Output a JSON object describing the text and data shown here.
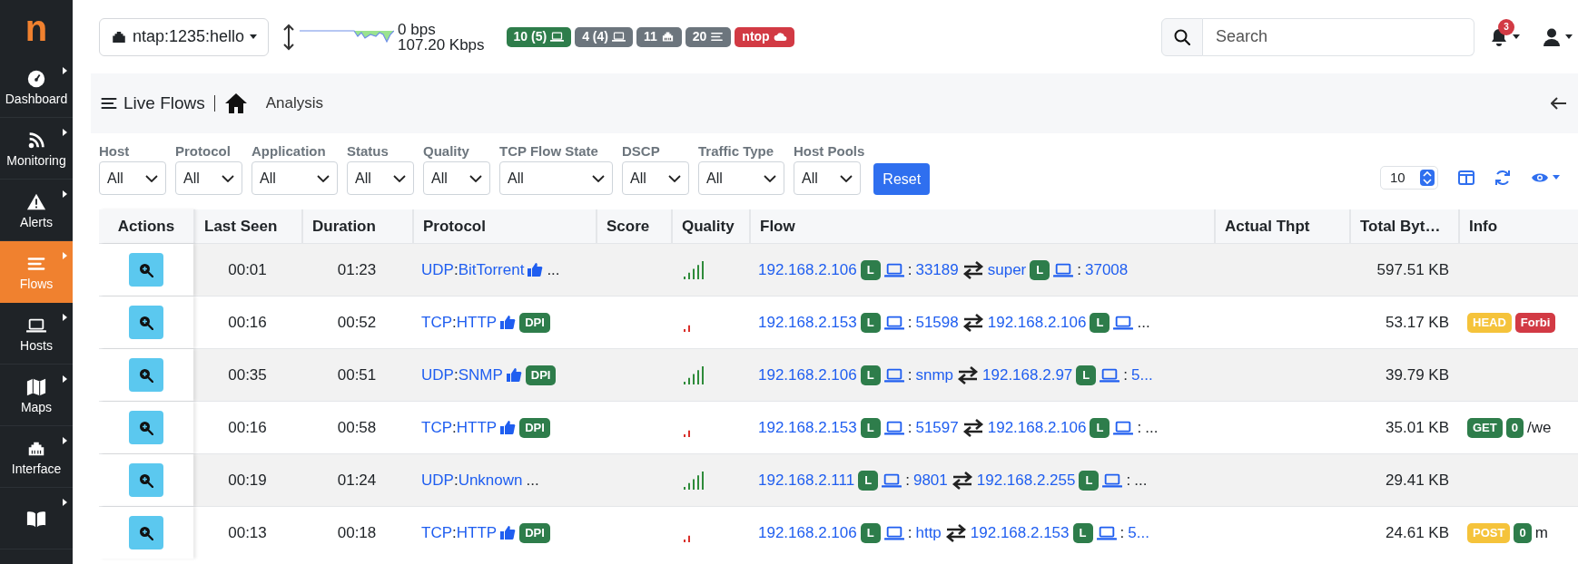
{
  "logo": "n",
  "sidebar": {
    "items": [
      {
        "label": "Dashboard",
        "kind": "gauge",
        "selected": false
      },
      {
        "label": "Monitoring",
        "kind": "signal",
        "selected": false
      },
      {
        "label": "Alerts",
        "kind": "warning",
        "selected": false
      },
      {
        "label": "Flows",
        "kind": "lines",
        "selected": true
      },
      {
        "label": "Hosts",
        "kind": "laptop",
        "selected": false
      },
      {
        "label": "Maps",
        "kind": "map",
        "selected": false
      },
      {
        "label": "Interface",
        "kind": "ethernet",
        "selected": false
      },
      {
        "kind": "book",
        "selected": false
      }
    ]
  },
  "topbar": {
    "interface": "ntap:1235:hello",
    "upload": "0 bps",
    "download": "107.20 Kbps",
    "badges": [
      {
        "text": "10 (5)",
        "kind": "laptop",
        "color": "#2e7d4b"
      },
      {
        "text": "4 (4)",
        "kind": "laptop",
        "color": "#6c757d"
      },
      {
        "text": "11",
        "kind": "ethernet",
        "color": "#6c757d"
      },
      {
        "text": "20",
        "kind": "lines",
        "color": "#6c757d"
      },
      {
        "text": "ntop",
        "kind": "cloud",
        "color": "#d23a44"
      }
    ],
    "search": {
      "placeholder": "Search"
    },
    "notifications": "3"
  },
  "breadcrumb": {
    "title": "Live Flows",
    "page": "Analysis"
  },
  "filters": [
    {
      "label": "Host",
      "value": "All"
    },
    {
      "label": "Protocol",
      "value": "All"
    },
    {
      "label": "Application",
      "value": "All"
    },
    {
      "label": "Status",
      "value": "All"
    },
    {
      "label": "Quality",
      "value": "All"
    },
    {
      "label": "TCP Flow State",
      "value": "All"
    },
    {
      "label": "DSCP",
      "value": "All"
    },
    {
      "label": "Traffic Type",
      "value": "All"
    },
    {
      "label": "Host Pools",
      "value": "All"
    }
  ],
  "reset": "Reset",
  "page_size": "10",
  "table": {
    "columns": [
      "Actions",
      "Last Seen",
      "Duration",
      "Protocol",
      "Score",
      "Quality",
      "Flow",
      "Actual Thpt",
      "Total Byt…",
      "Info"
    ],
    "rows": [
      {
        "last_seen": "00:01",
        "duration": "01:23",
        "l4": "UDP",
        "sep": ":",
        "app": "BitTorrent",
        "thumb": true,
        "more": "...",
        "quality_good": true,
        "client": {
          "host": "192.168.2.106",
          "badge": "L",
          "sep": ":",
          "port": "33189"
        },
        "server": {
          "host": "super",
          "badge": "L",
          "sep": ":",
          "port": "37008"
        },
        "bytes": "597.51 KB",
        "info": []
      },
      {
        "last_seen": "00:16",
        "duration": "00:52",
        "l4": "TCP",
        "sep": ":",
        "app": "HTTP",
        "thumb": true,
        "badge": "DPI",
        "quality_good": false,
        "client": {
          "host": "192.168.2.153",
          "badge": "L",
          "sep": ":",
          "port": "51598"
        },
        "server": {
          "host": "192.168.2.106",
          "badge": "L",
          "more": "..."
        },
        "bytes": "53.17 KB",
        "info": [
          {
            "text": "HEAD",
            "color": "#f5c33b"
          },
          {
            "text": "Forbi",
            "color": "#d23a44"
          }
        ]
      },
      {
        "last_seen": "00:35",
        "duration": "00:51",
        "l4": "UDP",
        "sep": ":",
        "app": "SNMP",
        "thumb": true,
        "badge": "DPI",
        "quality_good": true,
        "client": {
          "host": "192.168.2.106",
          "badge": "L",
          "sep": ":",
          "port": "snmp"
        },
        "server": {
          "host": "192.168.2.97",
          "badge": "L",
          "sep": ":",
          "port": "5..."
        },
        "bytes": "39.79 KB",
        "info": []
      },
      {
        "last_seen": "00:16",
        "duration": "00:58",
        "l4": "TCP",
        "sep": ":",
        "app": "HTTP",
        "thumb": true,
        "badge": "DPI",
        "quality_good": false,
        "client": {
          "host": "192.168.2.153",
          "badge": "L",
          "sep": ":",
          "port": "51597"
        },
        "server": {
          "host": "192.168.2.106",
          "badge": "L",
          "sep": ":",
          "more": "..."
        },
        "bytes": "35.01 KB",
        "info": [
          {
            "text": "GET",
            "color": "#2e7d4b"
          },
          {
            "text": "0",
            "color": "#2e7d4b"
          }
        ],
        "info_text": "/we"
      },
      {
        "last_seen": "00:19",
        "duration": "01:24",
        "l4": "UDP",
        "sep": ":",
        "app": "Unknown",
        "thumb": false,
        "more": "...",
        "quality_good": true,
        "client": {
          "host": "192.168.2.111",
          "badge": "L",
          "sep": ":",
          "port": "9801"
        },
        "server": {
          "host": "192.168.2.255",
          "badge": "L",
          "sep": ":",
          "more": "..."
        },
        "bytes": "29.41 KB",
        "info": []
      },
      {
        "last_seen": "00:13",
        "duration": "00:18",
        "l4": "TCP",
        "sep": ":",
        "app": "HTTP",
        "thumb": true,
        "badge": "DPI",
        "quality_good": false,
        "client": {
          "host": "192.168.2.106",
          "badge": "L",
          "sep": ":",
          "port": "http"
        },
        "server": {
          "host": "192.168.2.153",
          "badge": "L",
          "sep": ":",
          "port": "5..."
        },
        "bytes": "24.61 KB",
        "info": [
          {
            "text": "POST",
            "color": "#f5c33b"
          },
          {
            "text": "0",
            "color": "#2e7d4b"
          }
        ],
        "info_text": "m"
      }
    ]
  }
}
